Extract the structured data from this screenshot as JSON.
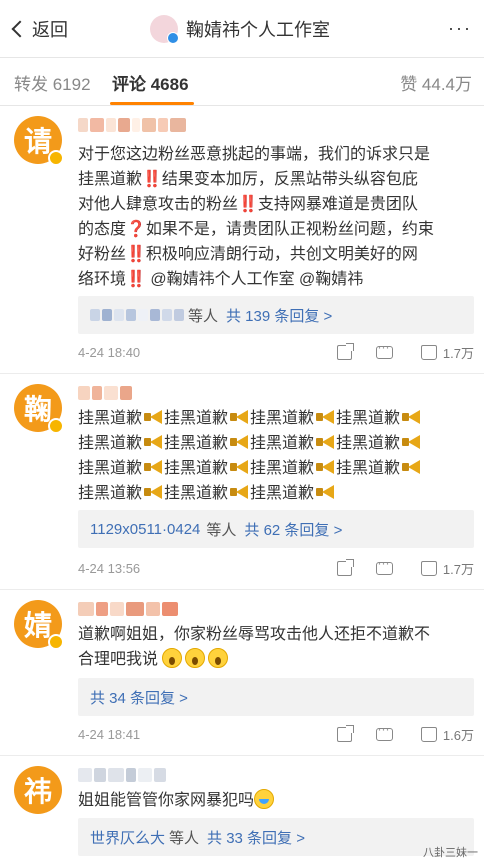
{
  "nav": {
    "back_label": "返回",
    "title": "鞠婧祎个人工作室",
    "more": "···"
  },
  "tabs": {
    "repost": "转发 6192",
    "comments": "评论 4686",
    "likes": "赞 44.4万"
  },
  "colors": {
    "accent": "#ff8200",
    "link": "#3f6fb5",
    "avatar_bg": "#f39a1a"
  },
  "comments": [
    {
      "avatar_char": "请",
      "text_lines": [
        "对于您这边粉丝恶意挑起的事端，我们的诉求只是",
        "挂黑道歉‼️结果变本加厉，反黑站带头纵容包庇",
        "对他人肆意攻击的粉丝‼️支持网暴难道是贵团队",
        "的态度❓如果不是，请贵团队正视粉丝问题，约束",
        "好粉丝‼️积极响应清朗行动，共创文明美好的网",
        "络环境‼️ @鞠婧祎个人工作室 @鞠婧祎"
      ],
      "reply_suffix": "等人",
      "reply_link": "共 139 条回复 >",
      "time": "4-24 18:40",
      "likes": "1.7万"
    },
    {
      "avatar_char": "鞠",
      "text_unit": "挂黑道歉",
      "reply_who": "1129x0511·0424",
      "reply_suffix": "等人",
      "reply_link": "共 62 条回复 >",
      "time": "4-24 13:56",
      "likes": "1.7万"
    },
    {
      "avatar_char": "婧",
      "text_lines": [
        "道歉啊姐姐，你家粉丝辱骂攻击他人还拒不道歉不",
        "合理吧我说"
      ],
      "reply_link": "共 34 条回复 >",
      "time": "4-24 18:41",
      "likes": "1.6万"
    },
    {
      "avatar_char": "祎",
      "text_lines": [
        "姐姐能管管你家网暴犯吗"
      ],
      "reply_who": "世界仄么大",
      "reply_suffix": "等人",
      "reply_link": "共 33 条回复 >"
    }
  ],
  "watermark": "八卦三妹一"
}
